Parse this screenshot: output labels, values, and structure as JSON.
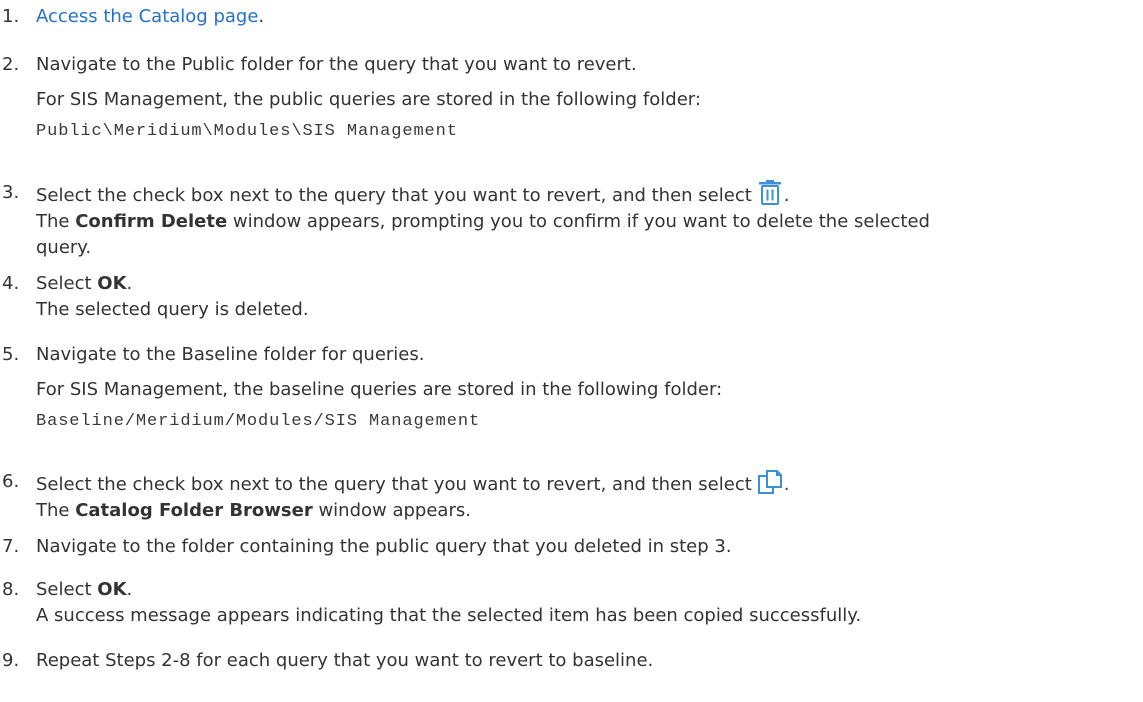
{
  "steps": [
    {
      "num": "1.",
      "link": "Access the Catalog page",
      "tail": "."
    },
    {
      "num": "2.",
      "text": "Navigate to the Public folder for the query that you want to revert.",
      "note": "For SIS Management, the public queries are stored in the following folder:",
      "path": "Public\\Meridium\\Modules\\SIS Management"
    },
    {
      "num": "3.",
      "text": "Select the check box next to the query that you want to revert, and then select",
      "icon": "trash-icon",
      "after_icon": ".",
      "r_pre": "The ",
      "r_bold": "Confirm Delete",
      "r_post1": " window appears, prompting you to confirm if you want to delete the selected",
      "r_post2": "query."
    },
    {
      "num": "4.",
      "pre": "Select ",
      "bold": "OK",
      "tail": ".",
      "result": "The selected query is deleted."
    },
    {
      "num": "5.",
      "text": "Navigate to the Baseline folder for queries.",
      "note": "For SIS Management, the baseline queries are stored in the following folder:",
      "path": "Baseline/Meridium/Modules/SIS Management"
    },
    {
      "num": "6.",
      "text": "Select the check box next to the query that you want to revert, and then select",
      "icon": "copy-icon",
      "after_icon": ".",
      "r_pre": "The ",
      "r_bold": "Catalog Folder Browser",
      "r_post": " window appears."
    },
    {
      "num": "7.",
      "text": "Navigate to the folder containing the public query that you deleted in step 3."
    },
    {
      "num": "8.",
      "pre": "Select ",
      "bold": "OK",
      "tail": ".",
      "result": "A success message appears indicating that the selected item has been copied successfully."
    },
    {
      "num": "9.",
      "text": "Repeat Steps 2-8 for each query that you want to revert to baseline."
    }
  ],
  "colors": {
    "link": "#2472c8",
    "icon": "#3d8fd6",
    "text": "#333333"
  }
}
